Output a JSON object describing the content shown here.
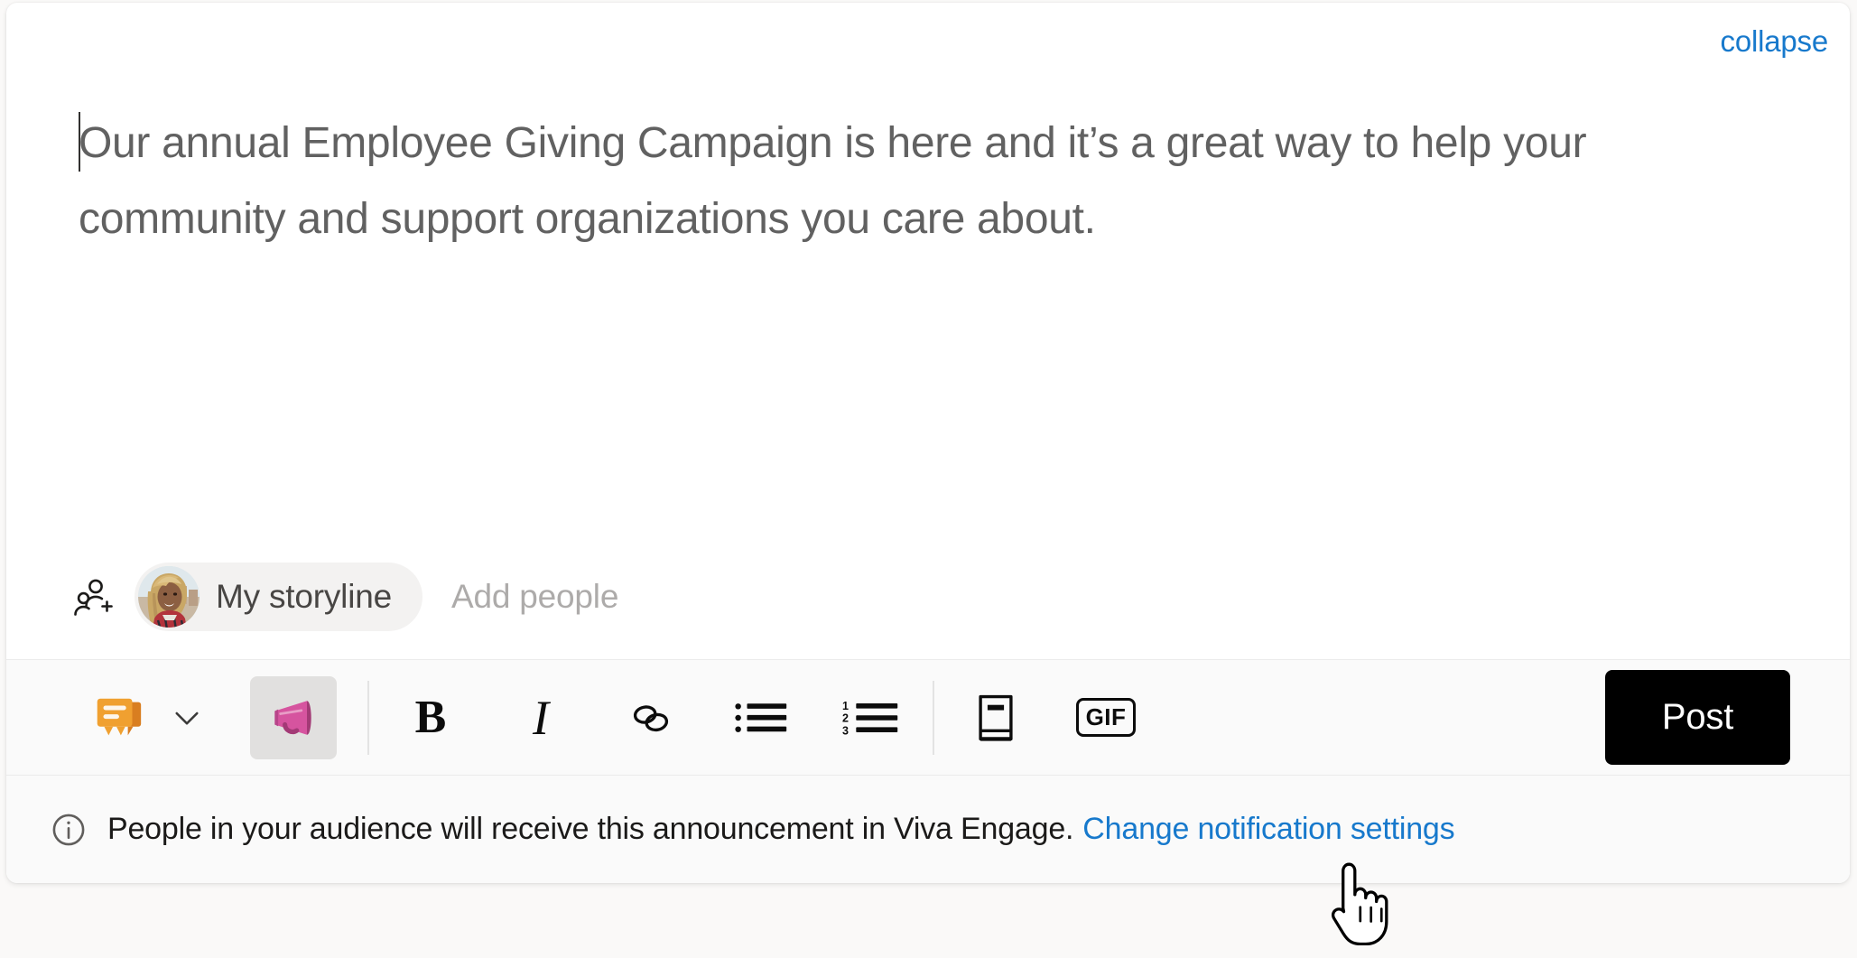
{
  "card": {
    "collapse_label": "collapse"
  },
  "editor": {
    "content": "Our annual Employee Giving Campaign is here and it’s a great way to help your community and support organizations you care about.",
    "has_caret": true
  },
  "audience": {
    "people_add_icon": "people-add-icon",
    "selected_pill_label": "My storyline",
    "avatar_alt": "user-avatar-photo",
    "add_people_placeholder": "Add people"
  },
  "toolbar": {
    "post_type_icon": "discussion-orange-icon",
    "post_type_chevron_icon": "chevron-down-icon",
    "announcement_icon": "announcement-megaphone-icon",
    "announcement_active": true,
    "buttons": [
      {
        "name": "bold-button",
        "label": "B",
        "icon": "bold-icon"
      },
      {
        "name": "italic-button",
        "label": "I",
        "icon": "italic-icon"
      },
      {
        "name": "link-button",
        "label": "",
        "icon": "link-icon"
      },
      {
        "name": "bulleted-list-button",
        "label": "",
        "icon": "bulleted-list-icon"
      },
      {
        "name": "numbered-list-button",
        "label": "",
        "icon": "numbered-list-icon"
      },
      {
        "name": "article-button",
        "label": "",
        "icon": "book-article-icon"
      },
      {
        "name": "gif-button",
        "label": "GIF",
        "icon": "gif-icon"
      }
    ],
    "gif_label": "GIF",
    "bold_label": "B",
    "italic_label": "I",
    "post_label": "Post"
  },
  "notice": {
    "info_icon": "info-circle-icon",
    "message": "People in your audience will receive this announcement in Viva Engage.",
    "link_label": "Change notification settings"
  },
  "cursor": {
    "type": "hand-pointer-cursor"
  },
  "colors": {
    "link_blue": "#1779cc",
    "text_gray": "#616161",
    "post_button_bg": "#000000",
    "toolbar_bg": "#fafafa",
    "pill_bg": "#f3f2f1",
    "active_icon_bg": "#e1e0df",
    "megaphone_pink": "#d6549f",
    "discussion_orange": "#f0a030"
  }
}
